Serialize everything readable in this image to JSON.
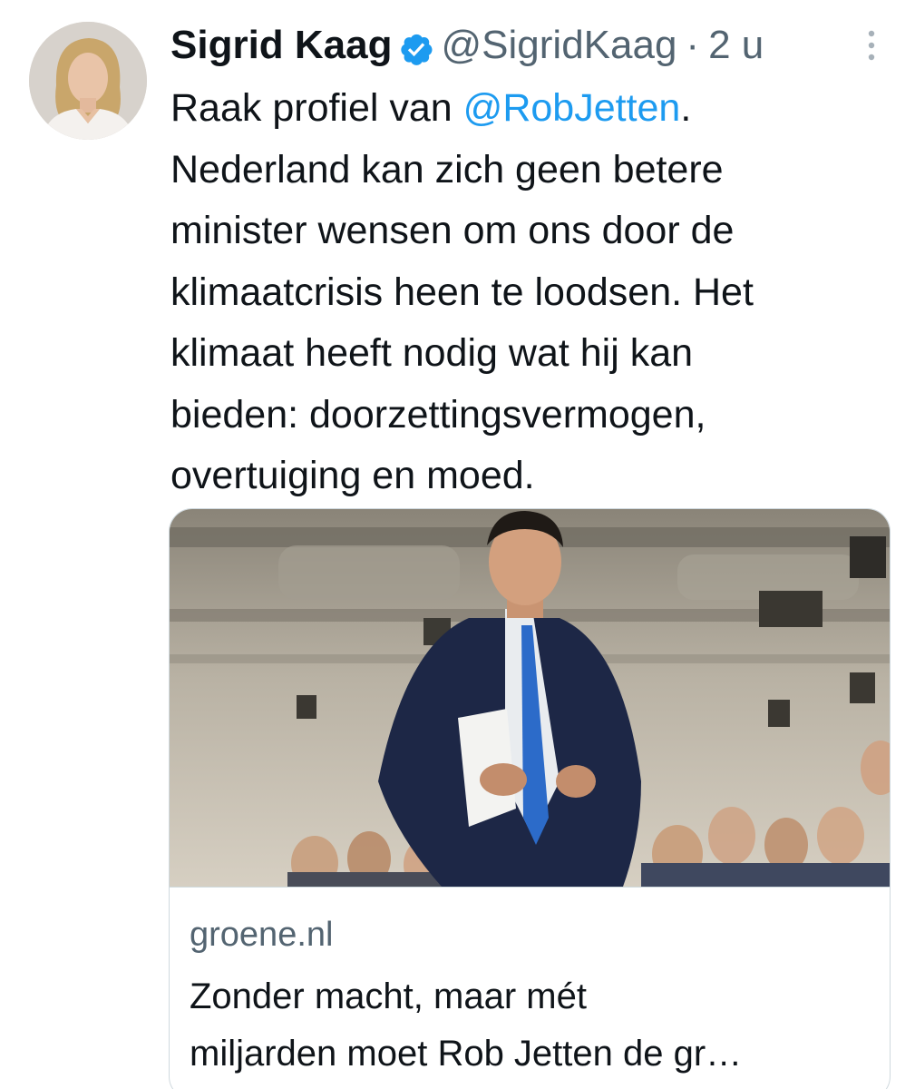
{
  "author": {
    "name": "Sigrid Kaag",
    "handle": "@SigridKaag",
    "separator": "·",
    "time": "2 u"
  },
  "tweet": {
    "line1_prefix": "Raak profiel van ",
    "line1_mention": "@RobJetten",
    "line1_suffix": ".",
    "line2": "Nederland kan zich geen betere",
    "line3": "minister wensen om ons door de",
    "line4": "klimaatcrisis heen te loodsen. Het",
    "line5": "klimaat heeft nodig wat hij kan",
    "line6": "bieden: doorzettingsvermogen,",
    "line7": "overtuiging en moed."
  },
  "card": {
    "domain": "groene.nl",
    "title_line1": "Zonder macht, maar mét",
    "title_line2": "miljarden moet Rob Jetten de gr…"
  },
  "colors": {
    "mention": "#1d9bf0",
    "secondary_text": "#536471",
    "verified_badge": "#1d9bf0",
    "card_border": "#cfd9de"
  },
  "icons": {
    "verified": "verified-badge-icon",
    "more": "more-vertical-icon"
  }
}
